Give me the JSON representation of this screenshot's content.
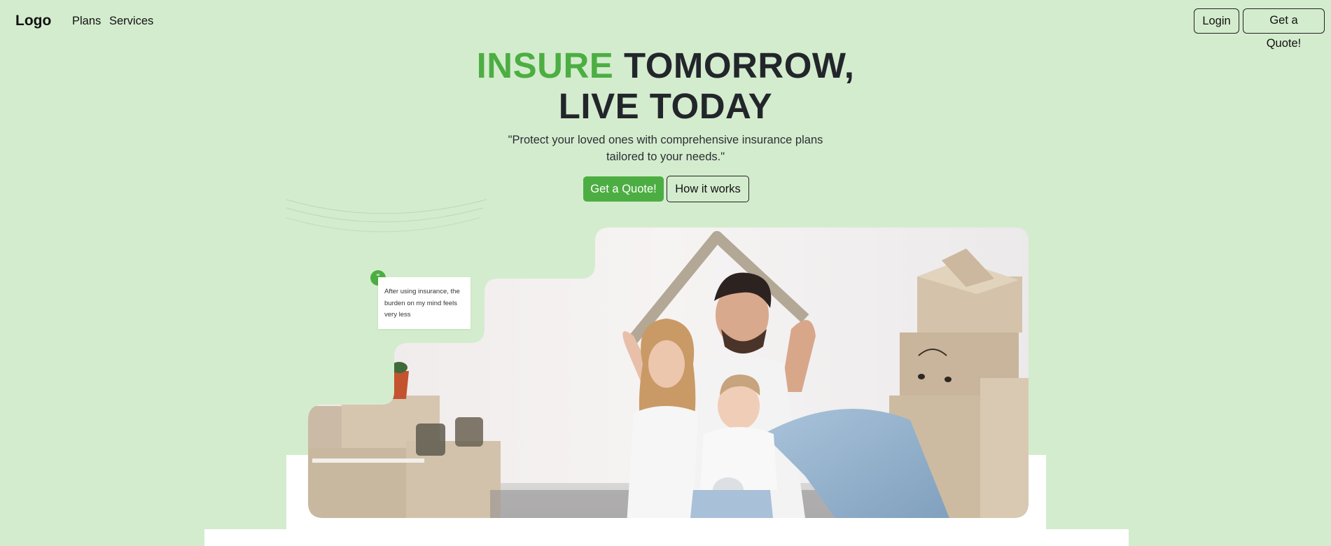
{
  "nav": {
    "logo": "Logo",
    "links": [
      "Plans",
      "Services"
    ],
    "login_label": "Login",
    "quote_label": "Get a Quote!"
  },
  "hero": {
    "title_accent": "INSURE",
    "title_rest": " TOMORROW,",
    "title_line2": "LIVE TODAY",
    "subtitle_line1": "\"Protect your loved ones with comprehensive insurance plans",
    "subtitle_line2": "tailored to your needs.\"",
    "primary_button": "Get a Quote!",
    "secondary_button": "How it works"
  },
  "testimonial": {
    "badge": "“",
    "text": "After using insurance, the burden on my mind feels very less"
  },
  "colors": {
    "background": "#d4ecce",
    "accent": "#4cae42",
    "text": "#22262b"
  }
}
